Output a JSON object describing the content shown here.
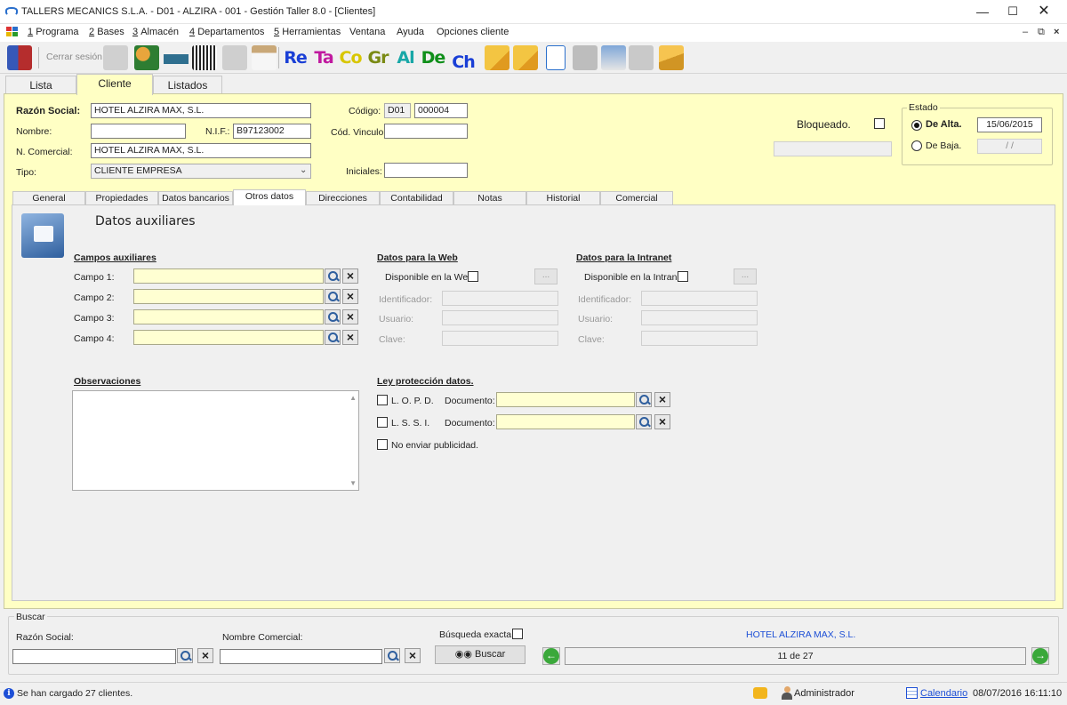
{
  "window": {
    "title": "TALLERS MECANICS S.L.A. - D01 - ALZIRA - 001 - Gestión Taller 8.0 - [Clientes]"
  },
  "menu": [
    {
      "label": "Programa",
      "key": "1"
    },
    {
      "label": "Bases",
      "key": "2"
    },
    {
      "label": "Almacén",
      "key": "3"
    },
    {
      "label": "Departamentos",
      "key": "4"
    },
    {
      "label": "Herramientas",
      "key": "5"
    },
    {
      "label": "Ventana",
      "key": ""
    },
    {
      "label": "Ayuda",
      "key": ""
    },
    {
      "label": "Opciones cliente",
      "key": ""
    }
  ],
  "toolbar": {
    "logout_label": "Cerrar sesión",
    "text_buttons": [
      {
        "label": "Re",
        "color": "#1a3fd6"
      },
      {
        "label": "Ta",
        "color": "#c0199f"
      },
      {
        "label": "Co",
        "color": "#d8c600"
      },
      {
        "label": "Gr",
        "color": "#7a8a14"
      },
      {
        "label": "Al",
        "color": "#17a7a7"
      },
      {
        "label": "De",
        "color": "#0f8f1a"
      },
      {
        "label": "Ch",
        "color": "#1a3fd6"
      }
    ]
  },
  "main_tabs": [
    "Lista",
    "Cliente",
    "Listados"
  ],
  "client": {
    "razon_social_label": "Razón Social:",
    "razon_social": "HOTEL ALZIRA MAX, S.L.",
    "nombre_label": "Nombre:",
    "nombre": "",
    "nif_label": "N.I.F.:",
    "nif": "B97123002",
    "ncomercial_label": "N. Comercial:",
    "ncomercial": "HOTEL ALZIRA MAX, S.L.",
    "tipo_label": "Tipo:",
    "tipo": "CLIENTE EMPRESA",
    "codigo_label": "Código:",
    "codigo_prefix": "D01",
    "codigo": "000004",
    "vinculo_label": "Cód. Vinculo",
    "vinculo": "",
    "iniciales_label": "Iniciales:",
    "iniciales": "",
    "bloqueado_label": "Bloqueado."
  },
  "estado": {
    "title": "Estado",
    "alta_label": "De Alta.",
    "alta_date": "15/06/2015",
    "baja_label": "De Baja.",
    "baja_date": " /  /"
  },
  "sub_tabs": [
    "General",
    "Propiedades",
    "Datos bancarios",
    "Otros datos",
    "Direcciones",
    "Contabilidad",
    "Notas",
    "Historial",
    "Comercial"
  ],
  "otros": {
    "section_title": "Datos auxiliares",
    "campos_title": "Campos auxiliares",
    "campos": [
      "Campo 1:",
      "Campo 2:",
      "Campo 3:",
      "Campo 4:"
    ],
    "web_title": "Datos para la Web",
    "web_disponible": "Disponible en la Web",
    "intranet_title": "Datos para la Intranet",
    "intranet_disponible": "Disponible en la Intranet",
    "identificador": "Identificador:",
    "usuario": "Usuario:",
    "clave": "Clave:",
    "dots": "...",
    "observaciones_title": "Observaciones",
    "ley_title": "Ley protección datos.",
    "lopd": "L. O. P. D.",
    "lssi": "L. S. S. I.",
    "documento": "Documento:",
    "no_publicidad": "No enviar publicidad."
  },
  "buscar": {
    "title": "Buscar",
    "razon_label": "Razón Social:",
    "comercial_label": "Nombre Comercial:",
    "exacta_label": "Búsqueda exacta.",
    "button": "Buscar",
    "current": "HOTEL ALZIRA MAX, S.L.",
    "position": "11 de 27"
  },
  "status": {
    "message": "Se han cargado 27 clientes.",
    "user": "Administrador",
    "calendar": "Calendario",
    "datetime": "08/07/2016 16:11:10"
  }
}
